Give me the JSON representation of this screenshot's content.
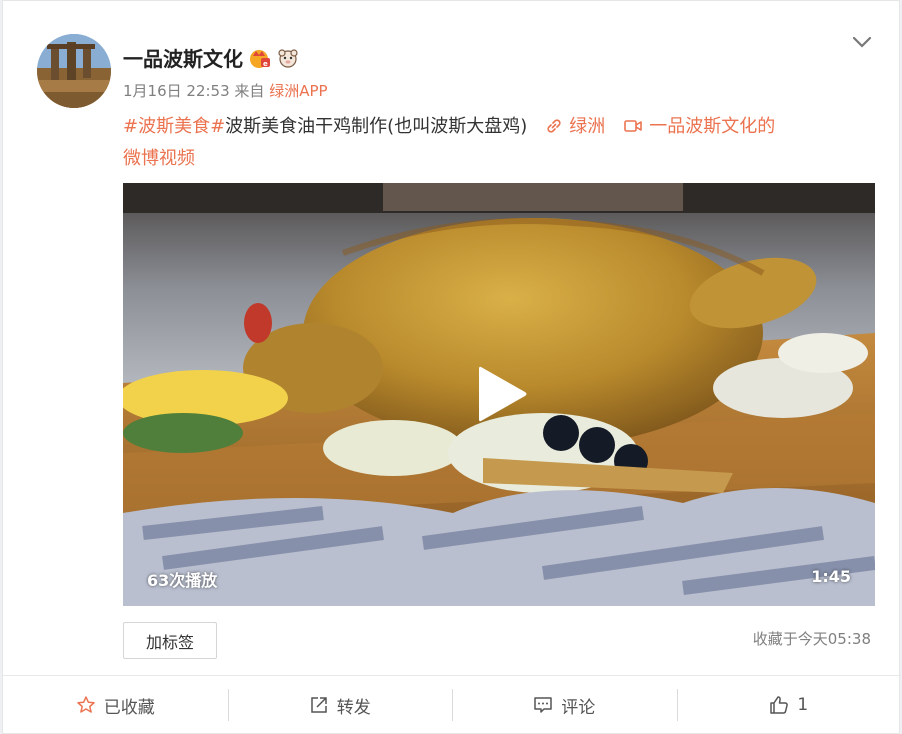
{
  "post": {
    "username": "一品波斯文化",
    "date": "1月16日 22:53",
    "from_label": "来自",
    "source": "绿洲APP",
    "text": {
      "hashtag": "#波斯美食#",
      "body": "波斯美食油干鸡制作(也叫波斯大盘鸡)",
      "link1": "绿洲",
      "link2_line1": "一品波斯文化的",
      "link2_line2": "微博视频"
    },
    "video": {
      "play_count": "63次播放",
      "duration": "1:45"
    },
    "add_tag_label": "加标签",
    "favorited_time": "收藏于今天05:38"
  },
  "actions": {
    "favorite": "已收藏",
    "repost": "转发",
    "comment": "评论",
    "like_count": "1"
  },
  "icons": {
    "favorite": "star-icon",
    "repost": "share-arrow-icon",
    "comment": "comment-icon",
    "like": "thumbs-up-icon",
    "link": "link-icon",
    "video": "video-camera-icon",
    "menu": "chevron-down-icon"
  },
  "colors": {
    "accent": "#eb7350",
    "text": "#333333",
    "muted": "#808080"
  }
}
